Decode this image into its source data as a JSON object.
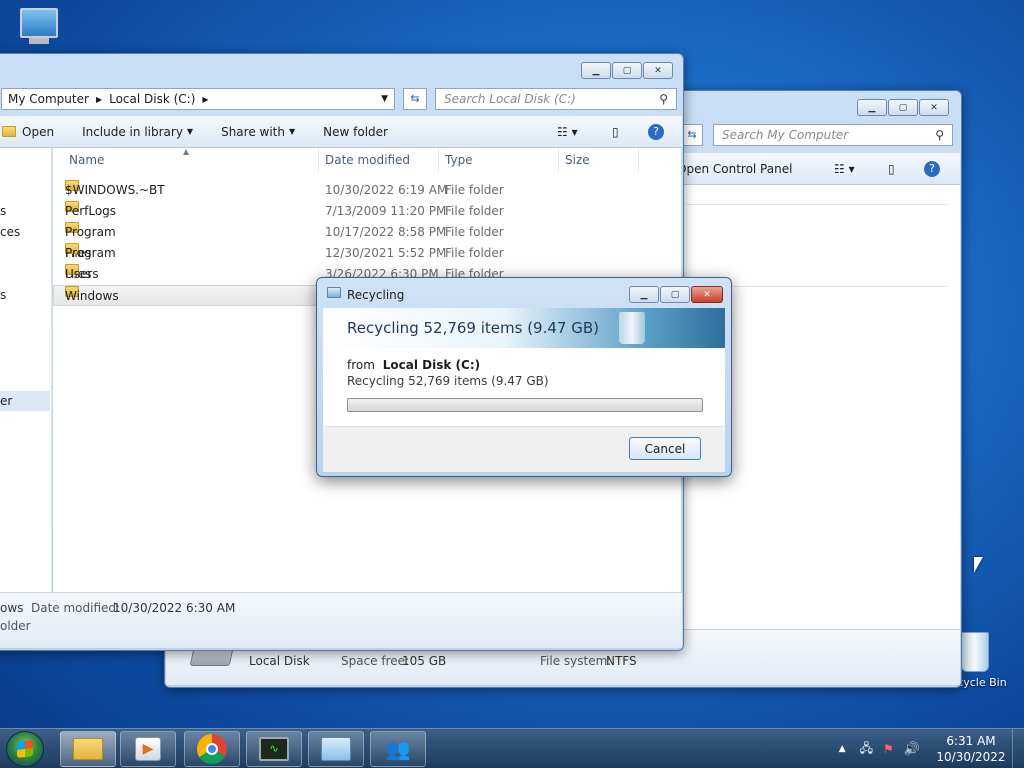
{
  "desktop": {
    "recycle_bin_label": "Recycle Bin"
  },
  "back_window": {
    "search_placeholder": "Search My Computer",
    "toolbar_open_cp": "Open Control Panel",
    "drive_name": "Local Disk",
    "space_free_label": "Space free:",
    "space_free_value": "105 GB",
    "fs_label": "File system:",
    "fs_value": "NTFS"
  },
  "front_window": {
    "breadcrumb": [
      "My Computer",
      "Local Disk (C:)"
    ],
    "search_placeholder": "Search Local Disk (C:)",
    "toolbar": {
      "open": "Open",
      "include": "Include in library",
      "share": "Share with",
      "new_folder": "New folder"
    },
    "sidebar_fragments": [
      "s",
      "ces",
      "s",
      "er"
    ],
    "columns": {
      "name": "Name",
      "date": "Date modified",
      "type": "Type",
      "size": "Size"
    },
    "files": [
      {
        "name": "$WINDOWS.~BT",
        "date": "10/30/2022 6:19 AM",
        "type": "File folder"
      },
      {
        "name": "PerfLogs",
        "date": "7/13/2009 11:20 PM",
        "type": "File folder"
      },
      {
        "name": "Program Files",
        "date": "10/17/2022 8:58 PM",
        "type": "File folder"
      },
      {
        "name": "Program Files (x86)",
        "date": "12/30/2021 5:52 PM",
        "type": "File folder"
      },
      {
        "name": "Users",
        "date": "3/26/2022 6:30 PM",
        "type": "File folder"
      },
      {
        "name": "Windows",
        "date": "",
        "type": ""
      }
    ],
    "status": {
      "name_fragment": "ows",
      "date_label": "Date modified:",
      "date_value": "10/30/2022 6:30 AM",
      "type_fragment": "older"
    }
  },
  "dialog": {
    "title": "Recycling",
    "header": "Recycling 52,769 items (9.47 GB)",
    "from_label": "from",
    "from_value": "Local Disk (C:)",
    "detail": "Recycling 52,769 items (9.47 GB)",
    "progress": 0,
    "cancel": "Cancel"
  },
  "taskbar": {
    "time": "6:31 AM",
    "date": "10/30/2022"
  }
}
